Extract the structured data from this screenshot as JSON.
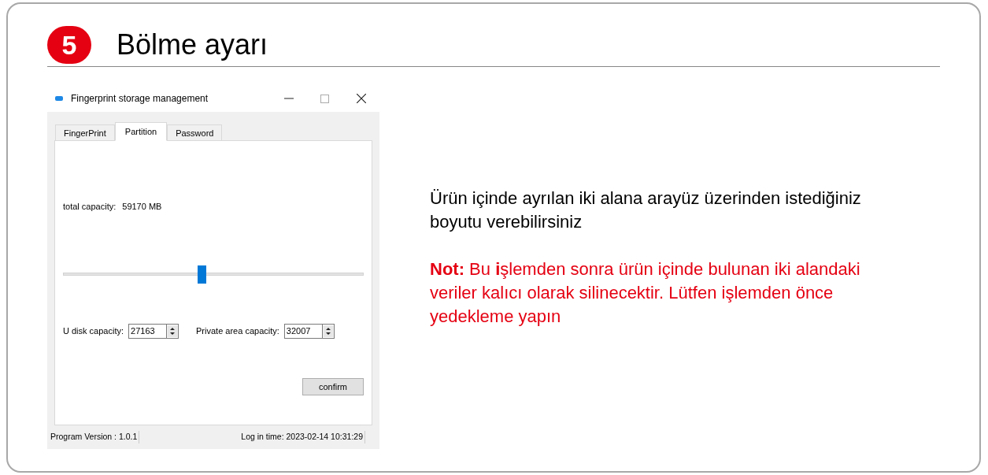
{
  "step": {
    "number": "5",
    "title": "Bölme ayarı"
  },
  "window": {
    "title": "Fingerprint storage management",
    "tabs": [
      {
        "label": "FingerPrint",
        "selected": false
      },
      {
        "label": "Partition",
        "selected": true
      },
      {
        "label": "Password",
        "selected": false
      }
    ],
    "total_capacity": {
      "label": "total capacity:",
      "value": "59170 MB"
    },
    "slider": {
      "level": 0.46
    },
    "fields": [
      {
        "label": "U disk capacity:",
        "value": "27163"
      },
      {
        "label": "Private area capacity:",
        "value": "32007"
      }
    ],
    "confirm_button": "confirm",
    "status_bar": {
      "version": "Program Version : 1.0.1",
      "login_time": "Log in time: 2023-02-14  10:31:29"
    }
  },
  "description": "Ürün içinde ayrılan iki alana arayüz üzerinden istediğiniz boyutu verebilirsiniz",
  "note": "**Not:** Bu **i**şlemden sonra ürün içinde bulunan iki alandaki veriler kalıcı olarak silinecektir. Lütfen işlemden önce yedekleme yapın"
}
